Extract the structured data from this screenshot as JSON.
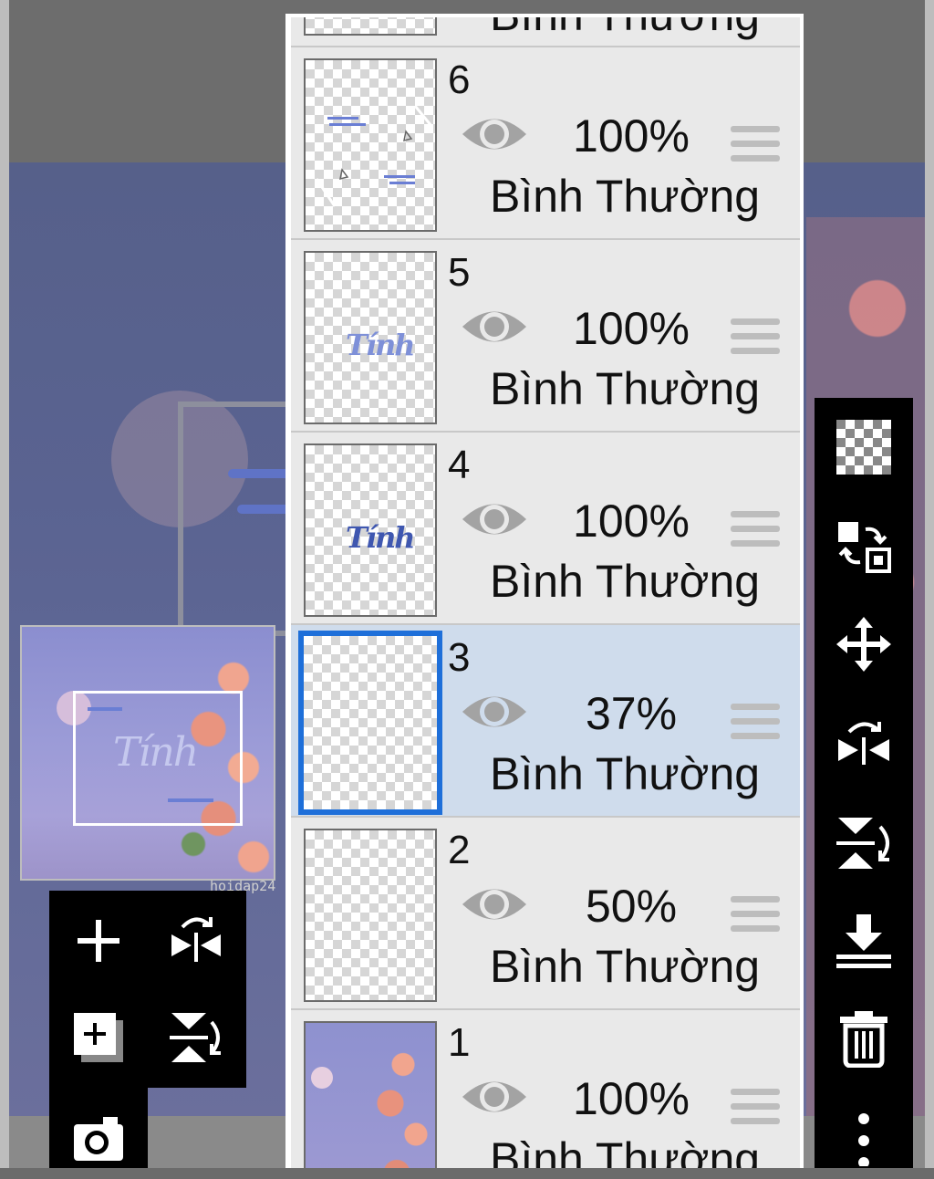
{
  "layers": [
    {
      "number": "",
      "opacity": "",
      "blend_mode": "Bình Thường"
    },
    {
      "number": "6",
      "opacity": "100%",
      "blend_mode": "Bình Thường"
    },
    {
      "number": "5",
      "opacity": "100%",
      "blend_mode": "Bình Thường",
      "thumb_text": "Tính"
    },
    {
      "number": "4",
      "opacity": "100%",
      "blend_mode": "Bình Thường",
      "thumb_text": "Tính"
    },
    {
      "number": "3",
      "opacity": "37%",
      "blend_mode": "Bình Thường",
      "selected": true
    },
    {
      "number": "2",
      "opacity": "50%",
      "blend_mode": "Bình Thường"
    },
    {
      "number": "1",
      "opacity": "100%",
      "blend_mode": "Bình Thường"
    }
  ],
  "navigator": {
    "preview_text": "Tính"
  },
  "watermark": "hoidap24",
  "colors": {
    "selection_border": "#1e6fd9",
    "selected_row": "#cfdcec",
    "row_bg": "#e9e9e9",
    "toolbar_bg": "#000000"
  },
  "right_toolbar": [
    "transparency-icon",
    "swap-layers-icon",
    "move-icon",
    "flip-horizontal-icon",
    "flip-vertical-icon",
    "merge-down-icon",
    "delete-icon",
    "more-icon"
  ],
  "left_toolbar": [
    "add-layer-icon",
    "flip-horizontal-icon",
    "duplicate-layer-icon",
    "flip-vertical-icon",
    "camera-icon"
  ]
}
